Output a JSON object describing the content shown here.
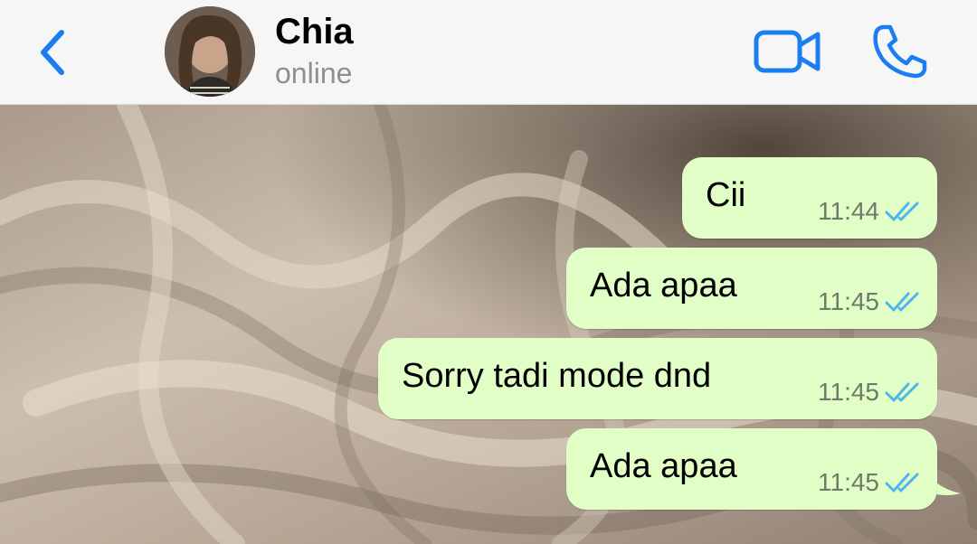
{
  "header": {
    "contact_name": "Chia",
    "status": "online",
    "back_icon": "chevron-left-icon",
    "video_icon": "video-camera-icon",
    "call_icon": "phone-icon",
    "accent_color": "#1a7df0"
  },
  "messages": [
    {
      "text": "Cii",
      "time": "11:44",
      "status": "read"
    },
    {
      "text": "Ada apaa",
      "time": "11:45",
      "status": "read"
    },
    {
      "text": "Sorry tadi mode dnd",
      "time": "11:45",
      "status": "read"
    },
    {
      "text": "Ada apaa",
      "time": "11:45",
      "status": "read"
    }
  ],
  "colors": {
    "outgoing_bubble": "#e1fec6",
    "read_ticks": "#4fb6ec",
    "header_background": "#f6f6f6"
  }
}
